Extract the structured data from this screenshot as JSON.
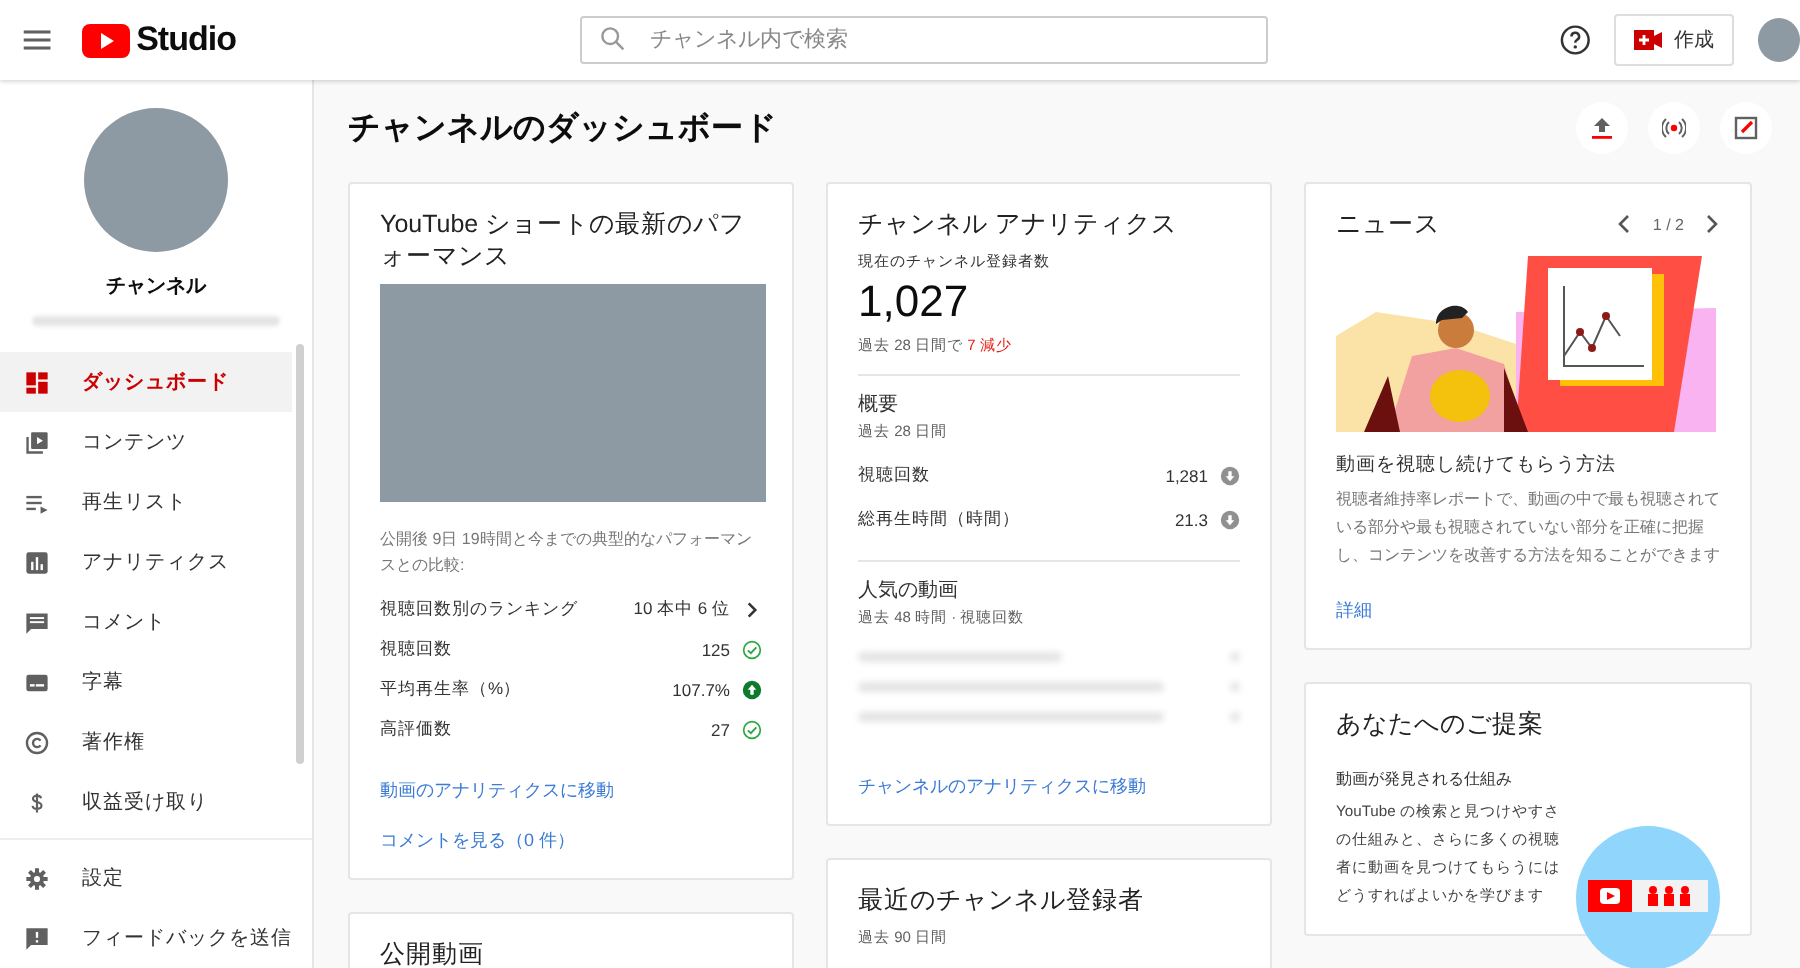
{
  "topbar": {
    "logo_text": "Studio",
    "search": {
      "placeholder": "チャンネル内で検索"
    },
    "create_label": "作成"
  },
  "sidebar": {
    "channel_name": "チャンネル",
    "items": [
      {
        "label": "ダッシュボード",
        "selected": true
      },
      {
        "label": "コンテンツ",
        "selected": false
      },
      {
        "label": "再生リスト",
        "selected": false
      },
      {
        "label": "アナリティクス",
        "selected": false
      },
      {
        "label": "コメント",
        "selected": false
      },
      {
        "label": "字幕",
        "selected": false
      },
      {
        "label": "著作権",
        "selected": false
      },
      {
        "label": "収益受け取り",
        "selected": false
      }
    ],
    "bottom_items": [
      {
        "label": "設定"
      },
      {
        "label": "フィードバックを送信"
      }
    ]
  },
  "page_title": "チャンネルのダッシュボード",
  "shorts_card": {
    "title": "YouTube ショートの最新のパフォーマンス",
    "caption": "公開後 9日 19時間と今までの典型的なパフォーマンスとの比較:",
    "rows": [
      {
        "label": "視聴回数別のランキング",
        "value": "10 本中 6 位",
        "kind": "chevron"
      },
      {
        "label": "視聴回数",
        "value": "125",
        "kind": "check"
      },
      {
        "label": "平均再生率（%）",
        "value": "107.7%",
        "kind": "up"
      },
      {
        "label": "高評価数",
        "value": "27",
        "kind": "check"
      }
    ],
    "links": [
      "動画のアナリティクスに移動",
      "コメントを見る（0 件）"
    ]
  },
  "published_card": {
    "title": "公開動画"
  },
  "analytics_card": {
    "title": "チャンネル アナリティクス",
    "subscribers_label": "現在のチャンネル登録者数",
    "subscribers": "1,027",
    "change_prefix": "過去 28 日間で",
    "change_value": "7 減少",
    "summary_title": "概要",
    "summary_period": "過去 28 日間",
    "rows": [
      {
        "label": "視聴回数",
        "value": "1,281",
        "kind": "down"
      },
      {
        "label": "総再生時間（時間）",
        "value": "21.3",
        "kind": "down"
      }
    ],
    "top_title": "人気の動画",
    "top_period": "過去 48 時間 · 視聴回数",
    "link": "チャンネルのアナリティクスに移動"
  },
  "subscribers_card": {
    "title": "最近のチャンネル登録者",
    "period": "過去 90 日間"
  },
  "news_card": {
    "title": "ニュース",
    "pager": "1 / 2",
    "headline": "動画を視聴し続けてもらう方法",
    "body": "視聴者維持率レポートで、動画の中で最も視聴されている部分や最も視聴されていない部分を正確に把握し、コンテンツを改善する方法を知ることができます",
    "link": "詳細"
  },
  "ideas_card": {
    "title": "あなたへのご提案",
    "subtitle": "動画が発見される仕組み",
    "body": "YouTube の検索と見つけやすさの仕組みと、さらに多くの視聴者に動画を見つけてもらうにはどうすればよいかを学びます"
  }
}
